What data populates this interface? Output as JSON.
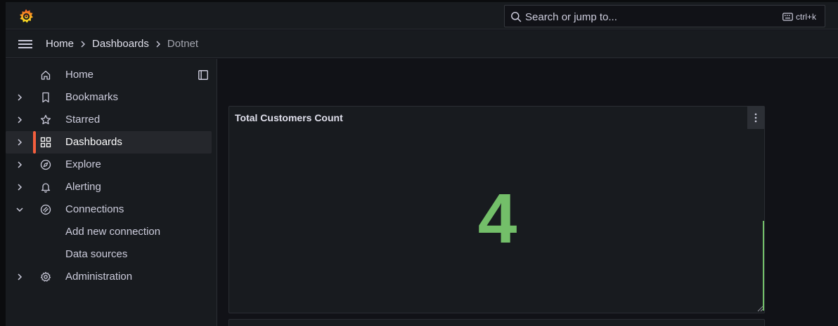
{
  "topbar": {
    "search_placeholder": "Search or jump to...",
    "shortcut": "ctrl+k"
  },
  "breadcrumbs": [
    {
      "label": "Home"
    },
    {
      "label": "Dashboards"
    },
    {
      "label": "Dotnet"
    }
  ],
  "sidebar": {
    "items": [
      {
        "label": "Home",
        "icon": "home-icon",
        "chevron": "none"
      },
      {
        "label": "Bookmarks",
        "icon": "bookmark-icon",
        "chevron": "right"
      },
      {
        "label": "Starred",
        "icon": "star-icon",
        "chevron": "right"
      },
      {
        "label": "Dashboards",
        "icon": "apps-icon",
        "chevron": "right",
        "active": true
      },
      {
        "label": "Explore",
        "icon": "compass-icon",
        "chevron": "right"
      },
      {
        "label": "Alerting",
        "icon": "bell-icon",
        "chevron": "right"
      },
      {
        "label": "Connections",
        "icon": "connections-icon",
        "chevron": "down"
      },
      {
        "label": "Add new connection",
        "icon": "",
        "chevron": "none"
      },
      {
        "label": "Data sources",
        "icon": "",
        "chevron": "none"
      },
      {
        "label": "Administration",
        "icon": "cog-icon",
        "chevron": "right"
      }
    ]
  },
  "panel": {
    "title": "Total Customers Count",
    "value": "4",
    "value_color": "#73bf69"
  },
  "colors": {
    "accent": "#f55f3e",
    "stat_green": "#73bf69"
  }
}
